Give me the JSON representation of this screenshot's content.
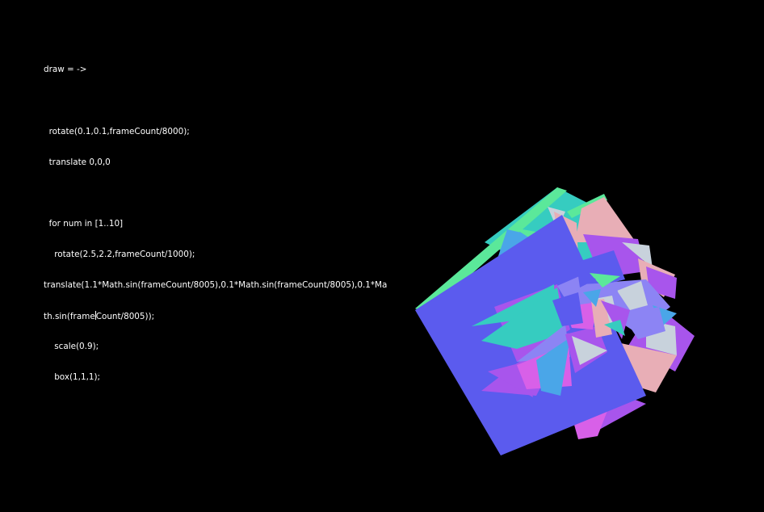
{
  "editor": {
    "lines": [
      "draw = ->",
      "",
      "  rotate(0.1,0.1,frameCount/8000);",
      "  translate 0,0,0",
      "",
      "  for num in [1..10]",
      "    rotate(2.5,2.2,frameCount/1000);",
      "translate(1.1*Math.sin(frameCount/8005),0.1*Math.sin(frameCount/8005),0.1*Ma",
      "th.sin(frameCount/8005));",
      "    scale(0.9);",
      "    box(1,1,1);"
    ],
    "caret_line_before": "th.sin(frame",
    "caret_line_after": "Count/8005));"
  },
  "colors": {
    "background": "#000000",
    "text": "#ffffff",
    "face_blue": "#5b5bee",
    "face_teal": "#36ccc0",
    "face_green": "#5be89a",
    "face_pink": "#e8aeb6",
    "face_purple": "#a855ec",
    "face_lavender": "#8c84f4",
    "face_gray": "#c8d2dc",
    "face_magenta": "#d860e8",
    "face_sky": "#4aa6e8"
  }
}
